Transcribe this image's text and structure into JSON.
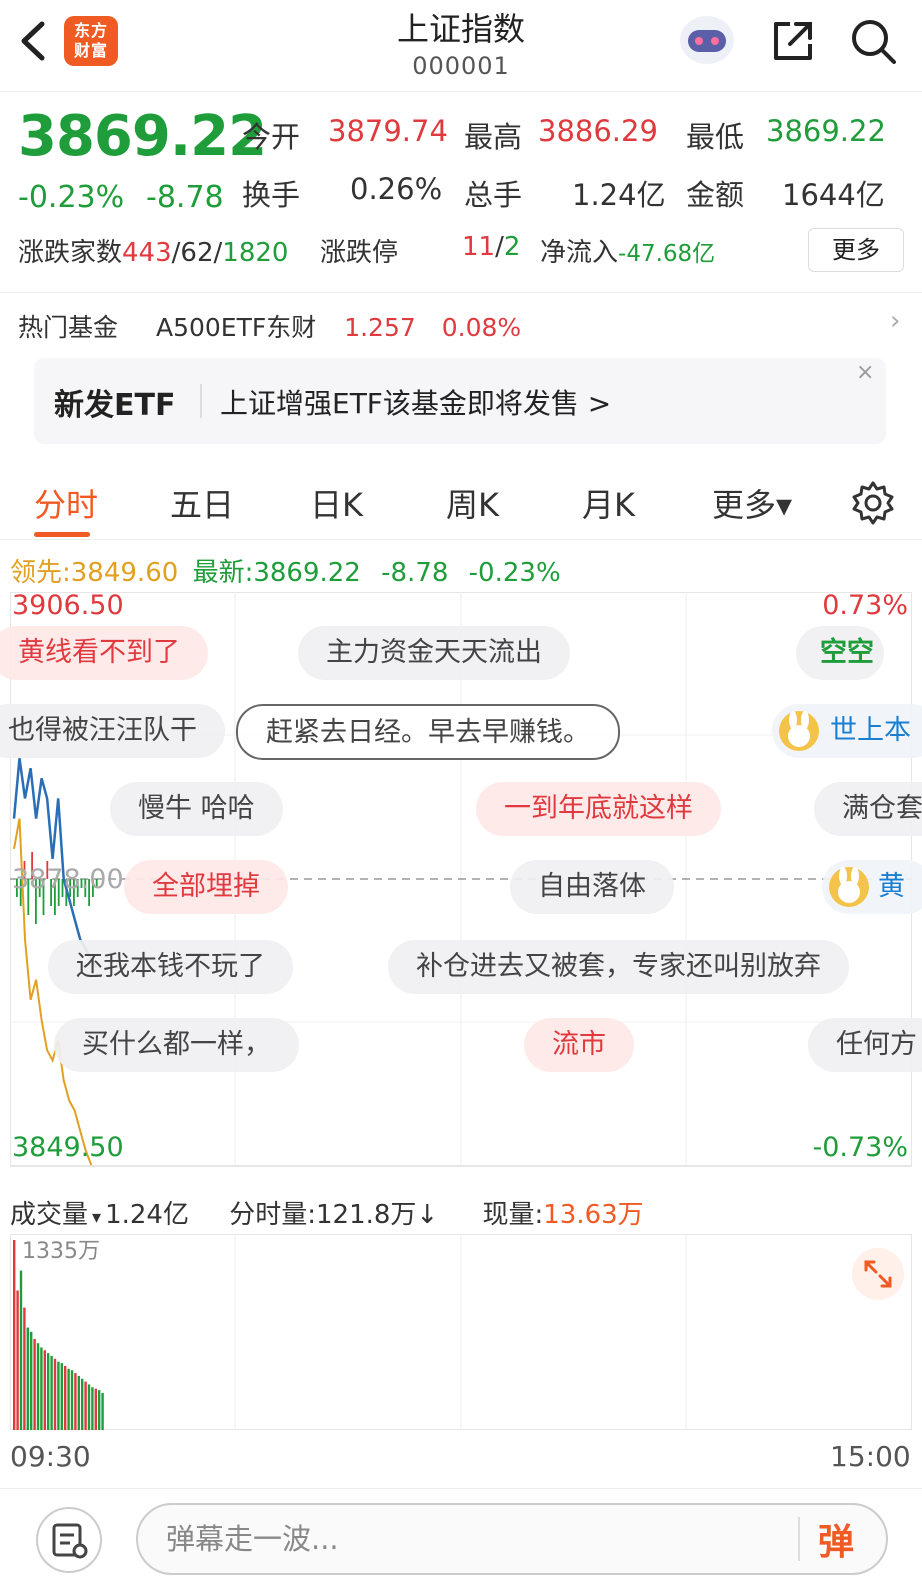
{
  "header": {
    "title": "上证指数",
    "code": "000001",
    "logo_text_1": "东方",
    "logo_text_2": "财富"
  },
  "quote": {
    "price": "3869.22",
    "pct": "-0.23%",
    "change": "-8.78",
    "open_label": "今开",
    "open_value": "3879.74",
    "high_label": "最高",
    "high_value": "3886.29",
    "low_label": "最低",
    "low_value": "3869.22",
    "turnover_label": "换手",
    "turnover_value": "0.26%",
    "volume_label": "总手",
    "volume_value": "1.24亿",
    "amount_label": "金额",
    "amount_value": "1644亿",
    "breadth_label": "涨跌家数",
    "breadth_up": "443",
    "breadth_flat": "62",
    "breadth_down": "1820",
    "limit_label": "涨跌停",
    "limit_up": "11",
    "limit_down": "2",
    "netflow_label": "净流入",
    "netflow_value": "-47.68亿",
    "more_label": "更多",
    "slash": "/"
  },
  "fund": {
    "label": "热门基金",
    "name": "A500ETF东财",
    "price": "1.257",
    "pct": "0.08%"
  },
  "banner": {
    "tag": "新发ETF",
    "text": "上证增强ETF该基金即将发售 >",
    "close": "×"
  },
  "tabs": [
    "分时",
    "五日",
    "日K",
    "周K",
    "月K",
    "更多▾"
  ],
  "leadline": {
    "lead_label": "领先:",
    "lead_value": "3849.60",
    "latest_label": "最新:",
    "latest_value": "3869.22",
    "latest_change": "-8.78",
    "latest_pct": "-0.23%"
  },
  "chart_data": {
    "type": "line",
    "y_top": "3906.50",
    "y_mid": "3878.00",
    "y_bottom": "3849.50",
    "pct_top": "0.73%",
    "pct_bottom": "-0.73%",
    "ylim": [
      3849.5,
      3906.5
    ],
    "prev_close": 3878.0,
    "series": [
      {
        "color": "#2a6fb5",
        "values": [
          3884,
          3890,
          3886,
          3889,
          3884,
          3888,
          3886,
          3880,
          3886,
          3878,
          3876,
          3874,
          3872,
          3871,
          3870,
          3869.2
        ]
      },
      {
        "color": "#e2a020",
        "values": [
          3881,
          3884,
          3872,
          3866,
          3868,
          3864,
          3861,
          3860,
          3862,
          3858,
          3856,
          3855,
          3853,
          3851,
          3849.6
        ]
      }
    ],
    "bars": [
      -2,
      -3,
      2,
      -4,
      3,
      -5,
      -2,
      -4,
      2,
      -3,
      -4,
      -3,
      -2,
      -3,
      -2,
      -3,
      -2,
      -1,
      -2,
      -3,
      -2,
      -1
    ]
  },
  "volume": {
    "label": "成交量",
    "dropdown": "▾",
    "value": "1.24亿",
    "minute_label": "分时量:",
    "minute_value": "121.8万↓",
    "current_label": "现量:",
    "current_value": "13.63万",
    "max_label": "1335万",
    "bars": [
      1335,
      980,
      1120,
      860,
      720,
      690,
      640,
      610,
      580,
      560,
      540,
      520,
      500,
      480,
      470,
      450,
      430,
      420,
      400,
      380,
      360,
      340,
      320,
      300,
      290,
      280,
      260
    ],
    "time_start": "09:30",
    "time_end": "15:00"
  },
  "danmaku": [
    "黄线看不到了",
    "主力资金天天流出",
    "空空",
    "也得被汪汪队干",
    "赶紧去日经。早去早赚钱。",
    "世上本",
    "慢牛 哈哈",
    "一到年底就这样",
    "满仓套",
    "全部埋掉",
    "自由落体",
    "黄",
    "还我本钱不玩了",
    "补仓进去又被套，专家还叫别放弃",
    "买什么都一样，",
    "流市",
    "任何方"
  ],
  "bottom": {
    "placeholder": "弹幕走一波...",
    "send": "弹"
  },
  "colors": {
    "up": "#e03a3e",
    "down": "#1f9d3a",
    "accent": "#f05a23"
  }
}
